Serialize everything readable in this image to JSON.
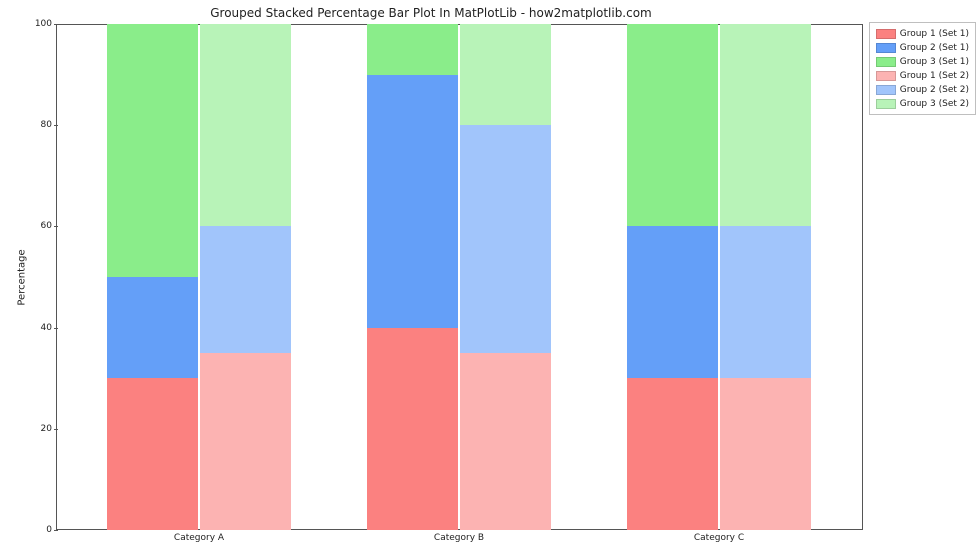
{
  "chart_data": {
    "type": "bar",
    "title": "Grouped Stacked Percentage Bar Plot In MatPlotLib - how2matplotlib.com",
    "xlabel": "",
    "ylabel": "Percentage",
    "ylim": [
      0,
      100
    ],
    "yticks": [
      0,
      20,
      40,
      60,
      80,
      100
    ],
    "categories": [
      "Category A",
      "Category B",
      "Category C"
    ],
    "sets": [
      {
        "name": "Set 1",
        "series": [
          {
            "name": "Group 1 (Set 1)",
            "values": [
              30,
              40,
              30
            ],
            "color": "#fb8180"
          },
          {
            "name": "Group 2 (Set 1)",
            "values": [
              20,
              50,
              30
            ],
            "color": "#649ff8"
          },
          {
            "name": "Group 3 (Set 1)",
            "values": [
              50,
              10,
              40
            ],
            "color": "#8aed8a"
          }
        ]
      },
      {
        "name": "Set 2",
        "series": [
          {
            "name": "Group 1 (Set 2)",
            "values": [
              35,
              35,
              30
            ],
            "color": "#fcb3b2"
          },
          {
            "name": "Group 2 (Set 2)",
            "values": [
              25,
              45,
              30
            ],
            "color": "#a1c5fb"
          },
          {
            "name": "Group 3 (Set 2)",
            "values": [
              40,
              20,
              40
            ],
            "color": "#b8f3b8"
          }
        ]
      }
    ],
    "legend": {
      "position": "upper-right-outside",
      "items": [
        {
          "label": "Group 1 (Set 1)",
          "color": "#fb8180"
        },
        {
          "label": "Group 2 (Set 1)",
          "color": "#649ff8"
        },
        {
          "label": "Group 3 (Set 1)",
          "color": "#8aed8a"
        },
        {
          "label": "Group 1 (Set 2)",
          "color": "#fcb3b2"
        },
        {
          "label": "Group 2 (Set 2)",
          "color": "#a1c5fb"
        },
        {
          "label": "Group 3 (Set 2)",
          "color": "#b8f3b8"
        }
      ]
    }
  }
}
